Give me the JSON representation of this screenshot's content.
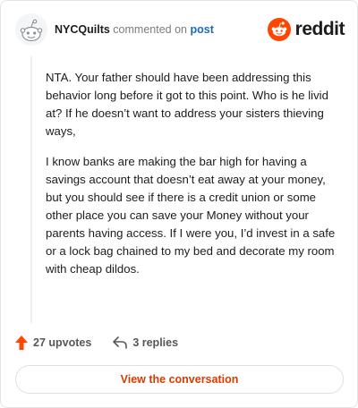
{
  "header": {
    "username": "NYCQuilts",
    "commented_on": "commented on",
    "post_link": "post",
    "logo_text": "reddit"
  },
  "comment": {
    "paragraphs": [
      "NTA. Your father should have been addressing this behavior long before it got to this point. Who is he livid at? If he doesn’t want to address your sisters thieving ways,",
      "I know banks are making the bar high for having a savings account that doesn’t eat away at your money, but you should see if there is a credit union or some other place you can save your Money without your parents having access. If I were you, I’d invest in a safe or a lock bag chained to my bed and decorate my room with cheap dildos."
    ]
  },
  "actions": {
    "upvotes": "27 upvotes",
    "replies": "3 replies"
  },
  "cta": {
    "label": "View the conversation"
  },
  "colors": {
    "accent": "#ff4500",
    "link": "#1a6bb8",
    "cta_text": "#d93a00"
  },
  "icons": [
    "snoo-avatar-icon",
    "reddit-logo-icon",
    "upvote-arrow-icon",
    "reply-arrow-icon"
  ]
}
